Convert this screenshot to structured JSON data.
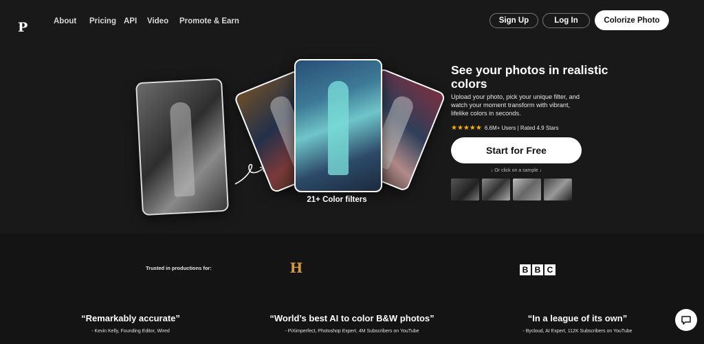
{
  "header": {
    "logo": "P",
    "nav": [
      "About",
      "Pricing",
      "API",
      "Video",
      "Promote & Earn"
    ],
    "signup": "Sign Up",
    "login": "Log In",
    "colorize": "Colorize Photo"
  },
  "hero": {
    "filters_caption": "21+ Color filters",
    "headline": "See your photos in realistic colors",
    "description": "Upload your photo, pick your unique filter, and watch your moment transform with vibrant, lifelike colors in seconds.",
    "stars": "★★★★★",
    "rating_text": "6.6M+ Users | Rated 4.9 Stars",
    "cta": "Start for Free",
    "sample_hint": "↓ Or click on a sample ↓"
  },
  "trusted": {
    "label": "Trusted in productions for:",
    "history_logo": "H",
    "bbc": [
      "B",
      "B",
      "C"
    ]
  },
  "quotes": [
    {
      "text": "“Remarkably accurate”",
      "source": "- Kevin Kelly, Founding Editor, Wired"
    },
    {
      "text": "“World’s best AI to color B&W photos”",
      "source": "- PiXimperfect, Photoshop Expert, 4M Subscribers on YouTube"
    },
    {
      "text": "“In a league of its own”",
      "source": "- Bycloud, AI Expert, 112K Subscribers on YouTube"
    }
  ],
  "colors": {
    "background": "#191919",
    "accent_white": "#ffffff",
    "star": "#f5b400",
    "history": "#d29b3f"
  }
}
